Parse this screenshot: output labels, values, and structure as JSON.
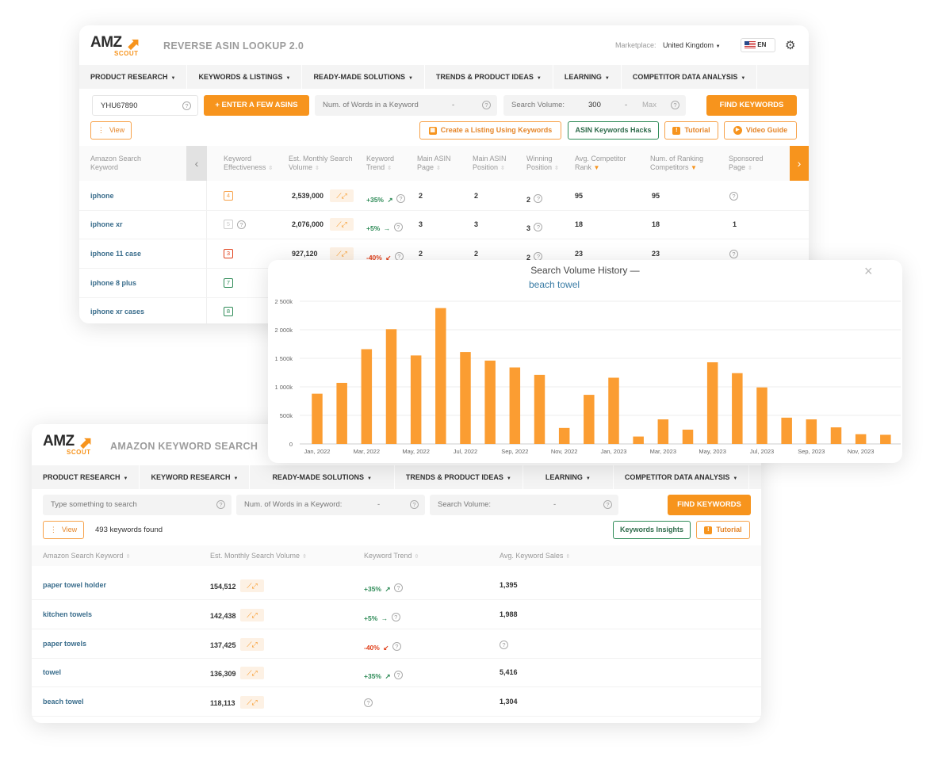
{
  "top": {
    "logo": {
      "text": "AMZ",
      "sub": "SCOUT"
    },
    "title": "REVERSE ASIN LOOKUP 2.0",
    "marketplace_label": "Marketplace:",
    "marketplace_value": "United Kingdom",
    "lang": "EN",
    "nav": [
      "PRODUCT RESEARCH",
      "KEYWORDS & LISTINGS",
      "READY-MADE SOLUTIONS",
      "TRENDS & PRODUCT IDEAS",
      "LEARNING",
      "COMPETITOR DATA ANALYSIS"
    ],
    "asin_value": "YHU67890",
    "enter_asins": "+ ENTER A FEW ASINS",
    "num_words_placeholder": "Num. of Words in a Keyword",
    "dash": "-",
    "search_volume_label": "Search Volume:",
    "search_volume_min": "300",
    "search_volume_max": "Max",
    "find_keywords": "FIND KEYWORDS",
    "view": "View",
    "create_listing": "Create a Listing Using Keywords",
    "asin_hacks": "ASIN Keywords Hacks",
    "tutorial": "Tutorial",
    "video_guide": "Video Guide",
    "headers": {
      "keyword": "Amazon Search Keyword",
      "effectiveness": "Keyword Effectiveness",
      "monthly": "Est. Monthly Search Volume",
      "trend": "Keyword Trend",
      "main_page": "Main ASIN Page",
      "main_pos": "Main ASIN Position",
      "win_pos": "Winning Position",
      "avg_rank": "Avg. Competitor Rank",
      "num_rank": "Num. of Ranking Competitors",
      "sponsored": "Sponsored Page"
    },
    "rows": [
      {
        "keyword": "iphone",
        "eff": "4",
        "effColor": "#f7a24a",
        "volume": "2,539,000",
        "trend": "+35%",
        "trendArrow": "↗",
        "trendDir": "up",
        "main_page": "2",
        "main_pos": "2",
        "win_pos": "2",
        "avg_rank": "95",
        "num_rank": "95",
        "sponsored": "?"
      },
      {
        "keyword": "iphone xr",
        "eff": "5",
        "effColor": "#cccccc",
        "volume": "2,076,000",
        "trend": "+5%",
        "trendArrow": "→",
        "trendDir": "up",
        "main_page": "3",
        "main_pos": "3",
        "win_pos": "3",
        "avg_rank": "18",
        "num_rank": "18",
        "sponsored": "1"
      },
      {
        "keyword": "iphone 11 case",
        "eff": "3",
        "effColor": "#e0401b",
        "volume": "927,120",
        "trend": "-40%",
        "trendArrow": "↙",
        "trendDir": "dn",
        "main_page": "2",
        "main_pos": "2",
        "win_pos": "2",
        "avg_rank": "23",
        "num_rank": "23",
        "sponsored": "?"
      },
      {
        "keyword": "iphone 8 plus",
        "eff": "7",
        "effColor": "#2e8b57"
      },
      {
        "keyword": "iphone xr cases",
        "eff": "8",
        "effColor": "#2e8b57"
      }
    ]
  },
  "bottom": {
    "logo": {
      "text": "AMZ",
      "sub": "SCOUT"
    },
    "title": "AMAZON KEYWORD SEARCH",
    "nav": [
      "PRODUCT RESEARCH",
      "KEYWORD RESEARCH",
      "READY-MADE SOLUTIONS",
      "TRENDS & PRODUCT IDEAS",
      "LEARNING",
      "COMPETITOR DATA ANALYSIS"
    ],
    "search_placeholder": "Type something to search",
    "num_words_placeholder": "Num. of Words in a Keyword:",
    "search_volume_label": "Search Volume:",
    "dash": "-",
    "find_keywords": "FIND KEYWORDS",
    "view": "View",
    "found": "493 keywords found",
    "insights": "Keywords Insights",
    "tutorial": "Tutorial",
    "headers": {
      "keyword": "Amazon Search Keyword",
      "monthly": "Est. Monthly Search Volume",
      "trend": "Keyword Trend",
      "sales": "Avg. Keyword Sales"
    },
    "rows": [
      {
        "keyword": "paper towel holder",
        "volume": "154,512",
        "trend": "+35%",
        "trendArrow": "↗",
        "trendDir": "up",
        "sales": "1,395"
      },
      {
        "keyword": "kitchen towels",
        "volume": "142,438",
        "trend": "+5%",
        "trendArrow": "→",
        "trendDir": "up",
        "sales": "1,988"
      },
      {
        "keyword": "paper towels",
        "volume": "137,425",
        "trend": "-40%",
        "trendArrow": "↙",
        "trendDir": "dn",
        "sales": "?"
      },
      {
        "keyword": "towel",
        "volume": "136,309",
        "trend": "+35%",
        "trendArrow": "↗",
        "trendDir": "up",
        "sales": "5,416"
      },
      {
        "keyword": "beach towel",
        "volume": "118,113",
        "trend": "",
        "trendArrow": "",
        "trendDir": "none",
        "sales": "1,304"
      }
    ]
  },
  "popup": {
    "title": "Search Volume History —",
    "keyword": "beach towel",
    "close": "×"
  },
  "chart_data": {
    "type": "bar",
    "title": "Search Volume History —",
    "subtitle": "beach towel",
    "ylim": [
      0,
      2500000
    ],
    "yticks": [
      0,
      500000,
      1000000,
      1500000,
      2000000,
      2500000
    ],
    "ytick_labels": [
      "0",
      "500k",
      "1 000k",
      "1 500k",
      "2 000k",
      "2 500k"
    ],
    "xtick_labels": [
      "Jan, 2022",
      "Mar, 2022",
      "May, 2022",
      "Jul, 2022",
      "Sep, 2022",
      "Nov, 2022",
      "Jan, 2023",
      "Mar, 2023",
      "May, 2023",
      "Jul, 2023",
      "Sep, 2023",
      "Nov, 2023"
    ],
    "categories": [
      "Jan 2022",
      "Feb 2022",
      "Mar 2022",
      "Apr 2022",
      "May 2022",
      "Jun 2022",
      "Jul 2022",
      "Aug 2022",
      "Sep 2022",
      "Oct 2022",
      "Nov 2022",
      "Dec 2022",
      "Jan 2023",
      "Feb 2023",
      "Mar 2023",
      "Apr 2023",
      "May 2023",
      "Jun 2023",
      "Jul 2023",
      "Aug 2023",
      "Sep 2023",
      "Oct 2023",
      "Nov 2023",
      "Dec 2023"
    ],
    "values": [
      880000,
      1070000,
      1660000,
      2010000,
      1550000,
      2380000,
      1610000,
      1460000,
      1340000,
      1210000,
      280000,
      860000,
      1160000,
      130000,
      430000,
      250000,
      1430000,
      1240000,
      990000,
      460000,
      430000,
      290000,
      170000,
      160000
    ],
    "color": "#fb9d32",
    "grid": true
  }
}
